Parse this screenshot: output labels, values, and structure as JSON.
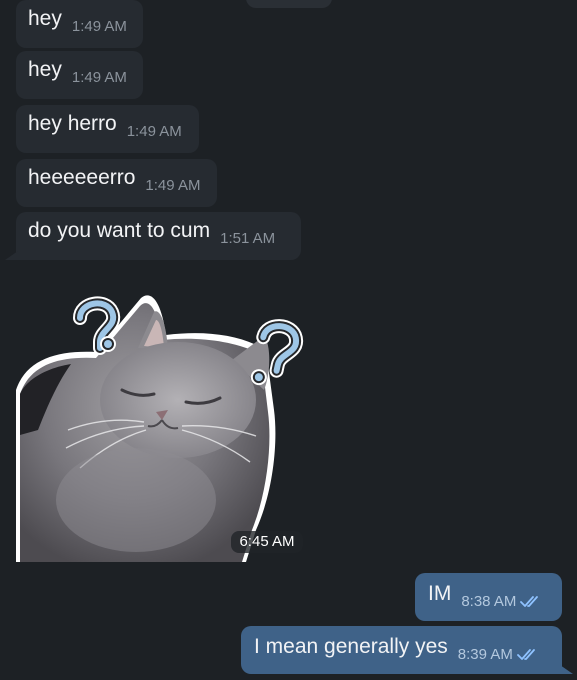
{
  "incoming": [
    {
      "text": "hey",
      "time": "1:49 AM"
    },
    {
      "text": "hey",
      "time": "1:49 AM"
    },
    {
      "text": "hey herro",
      "time": "1:49 AM"
    },
    {
      "text": "heeeeeerro",
      "time": "1:49 AM"
    },
    {
      "text": "do you want to cum",
      "time": "1:51 AM"
    }
  ],
  "sticker": {
    "description_icon": "cat-sticker",
    "time": "6:45 AM"
  },
  "outgoing": [
    {
      "text": "IM",
      "time": "8:38 AM",
      "status_icon": "double-check-icon"
    },
    {
      "text": "I mean generally yes",
      "time": "8:39 AM",
      "status_icon": "double-check-icon"
    }
  ],
  "colors": {
    "background": "#1d2125",
    "incoming_bubble": "#262b31",
    "outgoing_bubble": "#3f6288",
    "read_check": "#8fc2ff"
  }
}
